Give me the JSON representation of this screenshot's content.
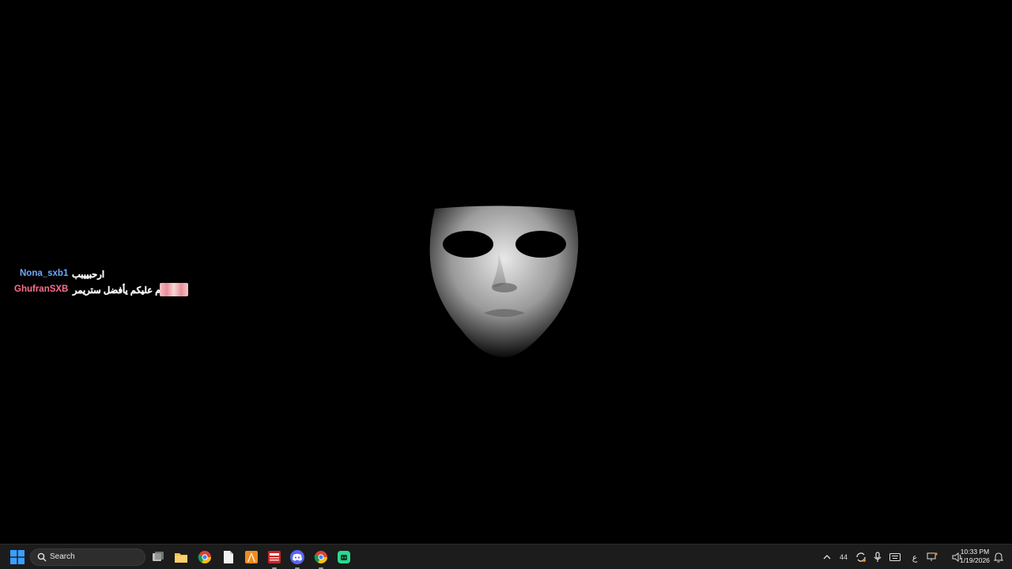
{
  "chat": {
    "messages": [
      {
        "user": "Nona_sxb1",
        "text": "ارحبييبب",
        "user_color": "#6fa8ff"
      },
      {
        "user": "GhufranSXB",
        "text": "السلام عليكم يأفضل ستريمر",
        "user_color": "#ff6f8e",
        "has_emote": true
      }
    ]
  },
  "taskbar": {
    "search_label": "Search",
    "apps": [
      "task-view",
      "file-explorer",
      "chrome",
      "blank-file",
      "vlc",
      "news-app",
      "discord",
      "chrome",
      "android-app"
    ],
    "tray": {
      "battery_or_count": "44",
      "ime_label": "ع",
      "time": "10:33 PM",
      "date": "1/19/2026"
    }
  },
  "colors": {
    "taskbar_bg": "#1c1c1c",
    "desktop_bg": "#000000",
    "windows_blue": "#3aa0ff",
    "discord": "#5865f2"
  }
}
